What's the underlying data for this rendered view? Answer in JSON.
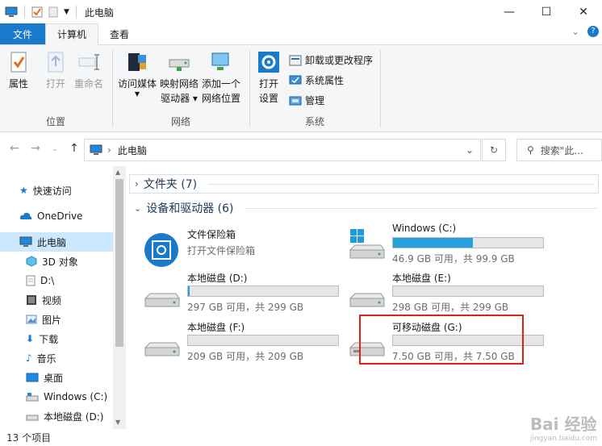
{
  "window": {
    "title": "此电脑"
  },
  "controls": {
    "minimize": "—",
    "maximize": "☐",
    "close": "✕"
  },
  "tabs": [
    {
      "label": "文件"
    },
    {
      "label": "计算机"
    },
    {
      "label": "查看"
    }
  ],
  "ribbon": {
    "groups": [
      {
        "label": "位置",
        "buttons": [
          "属性",
          "打开",
          "重命名"
        ]
      },
      {
        "label": "网络",
        "buttons": [
          "访问媒体",
          "映射网络",
          "驱动器",
          "添加一个",
          "网络位置"
        ]
      },
      {
        "label": "系统",
        "buttons": [
          "打开",
          "设置"
        ],
        "small": [
          "卸载或更改程序",
          "系统属性",
          "管理"
        ]
      }
    ]
  },
  "address": {
    "path": "此电脑",
    "search_placeholder": "搜索\"此..."
  },
  "nav": {
    "items": [
      {
        "label": "快速访问",
        "icon": "star-icon"
      },
      {
        "label": "OneDrive",
        "icon": "cloud-icon"
      },
      {
        "label": "此电脑",
        "icon": "computer-icon"
      },
      {
        "label": "3D 对象",
        "icon": "cube-icon"
      },
      {
        "label": "D:\\",
        "icon": "document-icon"
      },
      {
        "label": "视频",
        "icon": "video-icon"
      },
      {
        "label": "图片",
        "icon": "picture-icon"
      },
      {
        "label": "下载",
        "icon": "download-icon"
      },
      {
        "label": "音乐",
        "icon": "music-icon"
      },
      {
        "label": "桌面",
        "icon": "desktop-icon"
      },
      {
        "label": "Windows (C:)",
        "icon": "drive-icon"
      },
      {
        "label": "本地磁盘 (D:)",
        "icon": "drive-icon"
      }
    ]
  },
  "sections": {
    "folders": {
      "label": "文件夹 (7)"
    },
    "devices": {
      "label": "设备和驱动器 (6)"
    }
  },
  "drives": [
    {
      "name": "文件保险箱",
      "sub": "打开文件保险箱",
      "icon": "vault-icon"
    },
    {
      "name": "Windows (C:)",
      "sub": "46.9 GB 可用，共 99.9 GB",
      "used": 0.53,
      "icon": "windows-drive-icon"
    },
    {
      "name": "本地磁盘 (D:)",
      "sub": "297 GB 可用，共 299 GB",
      "used": 0.01,
      "icon": "drive-icon"
    },
    {
      "name": "本地磁盘 (E:)",
      "sub": "298 GB 可用，共 299 GB",
      "used": 0.0,
      "icon": "drive-icon"
    },
    {
      "name": "本地磁盘 (F:)",
      "sub": "209 GB 可用，共 209 GB",
      "used": 0.0,
      "icon": "drive-icon"
    },
    {
      "name": "可移动磁盘 (G:)",
      "sub": "7.50 GB 可用，共 7.50 GB",
      "used": 0.0,
      "icon": "removable-drive-icon"
    }
  ],
  "status": {
    "count": "13 个项目"
  },
  "watermark": {
    "text": "Bai 经验",
    "url": "jingyan.baidu.com"
  },
  "colors": {
    "accent": "#1979ca",
    "bar_fill": "#26a0da",
    "highlight": "#e0201a",
    "selected": "#cce8ff"
  }
}
